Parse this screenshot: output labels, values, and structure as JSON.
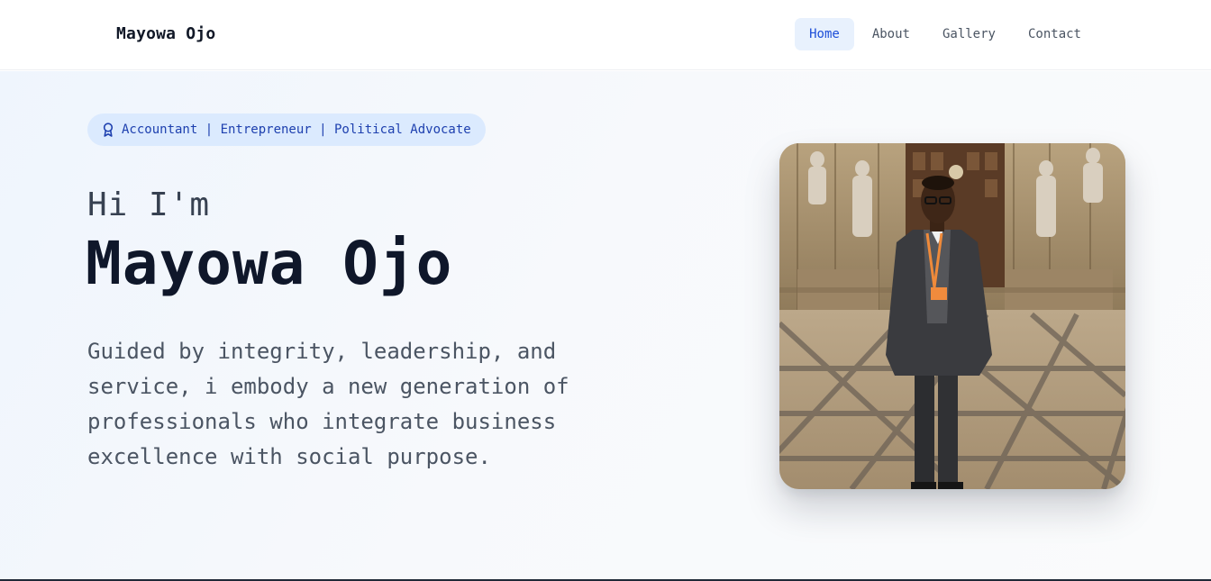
{
  "header": {
    "logo": "Mayowa Ojo",
    "nav": [
      {
        "label": "Home",
        "active": true
      },
      {
        "label": "About",
        "active": false
      },
      {
        "label": "Gallery",
        "active": false
      },
      {
        "label": "Contact",
        "active": false
      }
    ]
  },
  "hero": {
    "badge_icon": "award-icon",
    "badge_text": "Accountant | Entrepreneur | Political Advocate",
    "greeting": "Hi I'm",
    "name": "Mayowa Ojo",
    "description": "Guided by integrity, leadership, and service, i embody a new generation of professionals who integrate business excellence with social purpose."
  },
  "colors": {
    "accent": "#1d4ed8",
    "accent_bg": "#dbeafe",
    "text_dark": "#0f172a",
    "text_muted": "#4b5563"
  }
}
